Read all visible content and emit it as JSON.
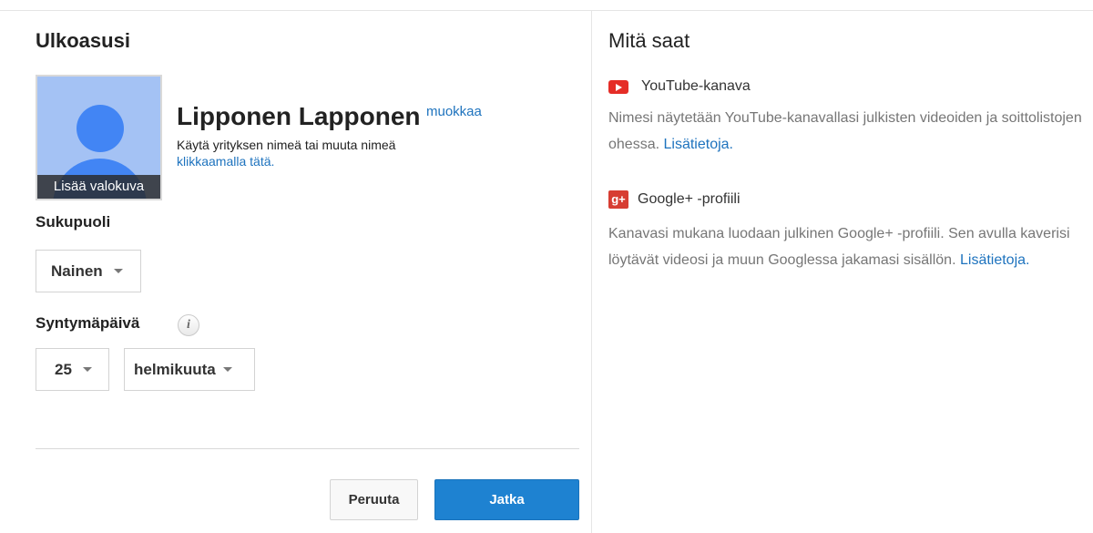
{
  "left": {
    "title": "Ulkoasusi",
    "avatar": {
      "add_photo_label": "Lisää valokuva"
    },
    "profile": {
      "name": "Lipponen Lapponen",
      "edit_label": "muokkaa",
      "hint_text": "Käytä yrityksen nimeä tai muuta nimeä",
      "hint_link": "klikkaamalla tätä."
    },
    "gender": {
      "label": "Sukupuoli",
      "selected": "Nainen"
    },
    "birthday": {
      "label": "Syntymäpäivä",
      "day": "25",
      "month": "helmikuuta"
    },
    "buttons": {
      "cancel": "Peruuta",
      "continue": "Jatka"
    }
  },
  "right": {
    "title": "Mitä saat",
    "features": [
      {
        "icon": "youtube-icon",
        "title": "YouTube-kanava",
        "description": "Nimesi näytetään YouTube-kanavallasi julkisten videoiden ja soittolistojen ohessa.",
        "link": "Lisätietoja."
      },
      {
        "icon": "google-plus-icon",
        "title": "Google+ -profiili",
        "description": "Kanavasi mukana luodaan julkinen Google+ -profiili. Sen avulla kaverisi löytävät videosi ja muun Googlessa jakamasi sisällön.",
        "link": "Lisätietoja."
      }
    ]
  },
  "colors": {
    "link": "#1e73be",
    "primary_button": "#1e82d1",
    "youtube_red": "#e52d27",
    "google_plus_red": "#d73d32",
    "avatar_bg": "#a4c2f4",
    "avatar_fg": "#4285f4"
  }
}
